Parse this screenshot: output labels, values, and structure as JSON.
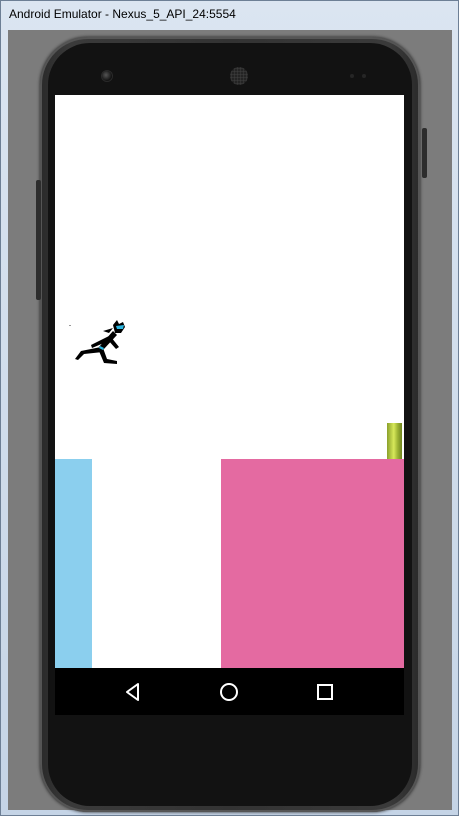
{
  "window": {
    "title": "Android Emulator - Nexus_5_API_24:5554"
  },
  "device": {
    "model_icon": "nexus-5-phone-frame"
  },
  "navbar": {
    "back_icon": "back-triangle-icon",
    "home_icon": "home-circle-icon",
    "recents_icon": "recents-square-icon"
  },
  "game": {
    "colors": {
      "blue_block": "#8bcfee",
      "pink_block": "#e46aa1",
      "pipe": "#b8cc45",
      "background": "#ffffff"
    }
  }
}
